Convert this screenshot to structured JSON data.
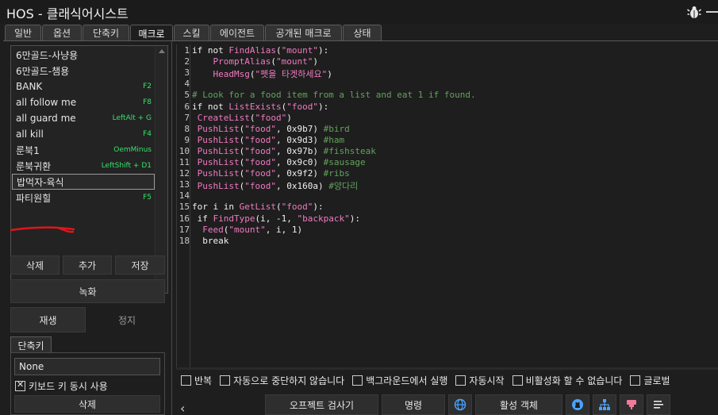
{
  "window": {
    "title": "HOS - 클래식어시스트"
  },
  "tabs": [
    "일반",
    "옵션",
    "단축키",
    "매크로",
    "스킬",
    "에이전트",
    "공개된 매크로",
    "상태"
  ],
  "active_tab": "매크로",
  "macros": [
    {
      "name": "6만골드-사냥용",
      "hotkey": ""
    },
    {
      "name": "6만골드-챔용",
      "hotkey": ""
    },
    {
      "name": "BANK",
      "hotkey": "F2"
    },
    {
      "name": "all follow me",
      "hotkey": "F8"
    },
    {
      "name": "all guard me",
      "hotkey": "LeftAlt + G"
    },
    {
      "name": "all kill",
      "hotkey": "F4"
    },
    {
      "name": "룬북1",
      "hotkey": "OemMinus"
    },
    {
      "name": "룬북귀환",
      "hotkey": "LeftShift + D1"
    },
    {
      "name": "밥먹자-육식",
      "hotkey": ""
    },
    {
      "name": "파티원힐",
      "hotkey": "F5"
    }
  ],
  "selected_macro": "밥먹자-육식",
  "buttons": {
    "delete": "삭제",
    "add": "추가",
    "save": "저장",
    "record": "녹화",
    "play": "재생",
    "stop": "정지"
  },
  "hotkey_panel": {
    "tab_label": "단축키",
    "value": "None",
    "checkbox_label": "키보드 키 동시 사용",
    "checkbox_checked": true,
    "delete_label": "삭제"
  },
  "editor": {
    "lines": [
      [
        [
          "kw",
          "if not "
        ],
        [
          "fn",
          "FindAlias"
        ],
        [
          "kw",
          "("
        ],
        [
          "str",
          "\"mount\""
        ],
        [
          "kw",
          "):"
        ]
      ],
      [
        [
          "kw",
          "    "
        ],
        [
          "fn",
          "PromptAlias"
        ],
        [
          "kw",
          "("
        ],
        [
          "str",
          "\"mount\""
        ],
        [
          "kw",
          ")"
        ]
      ],
      [
        [
          "kw",
          "    "
        ],
        [
          "fn",
          "HeadMsg"
        ],
        [
          "kw",
          "("
        ],
        [
          "str",
          "\"펫을 타겟하세요\""
        ],
        [
          "kw",
          ")"
        ]
      ],
      [],
      [
        [
          "cm",
          "# Look for a food item from a list and eat 1 if found."
        ]
      ],
      [
        [
          "kw",
          "if not "
        ],
        [
          "fn",
          "ListExists"
        ],
        [
          "kw",
          "("
        ],
        [
          "str",
          "\"food\""
        ],
        [
          "kw",
          "):"
        ]
      ],
      [
        [
          "kw",
          " "
        ],
        [
          "fn",
          "CreateList"
        ],
        [
          "kw",
          "("
        ],
        [
          "str",
          "\"food\""
        ],
        [
          "kw",
          ")"
        ]
      ],
      [
        [
          "kw",
          " "
        ],
        [
          "fn",
          "PushList"
        ],
        [
          "kw",
          "("
        ],
        [
          "str",
          "\"food\""
        ],
        [
          "kw",
          ", 0x9b7) "
        ],
        [
          "cm",
          "#bird"
        ]
      ],
      [
        [
          "kw",
          " "
        ],
        [
          "fn",
          "PushList"
        ],
        [
          "kw",
          "("
        ],
        [
          "str",
          "\"food\""
        ],
        [
          "kw",
          ", 0x9d3) "
        ],
        [
          "cm",
          "#ham"
        ]
      ],
      [
        [
          "kw",
          " "
        ],
        [
          "fn",
          "PushList"
        ],
        [
          "kw",
          "("
        ],
        [
          "str",
          "\"food\""
        ],
        [
          "kw",
          ", 0x97b) "
        ],
        [
          "cm",
          "#fishsteak"
        ]
      ],
      [
        [
          "kw",
          " "
        ],
        [
          "fn",
          "PushList"
        ],
        [
          "kw",
          "("
        ],
        [
          "str",
          "\"food\""
        ],
        [
          "kw",
          ", 0x9c0) "
        ],
        [
          "cm",
          "#sausage"
        ]
      ],
      [
        [
          "kw",
          " "
        ],
        [
          "fn",
          "PushList"
        ],
        [
          "kw",
          "("
        ],
        [
          "str",
          "\"food\""
        ],
        [
          "kw",
          ", 0x9f2) "
        ],
        [
          "cm",
          "#ribs"
        ]
      ],
      [
        [
          "kw",
          " "
        ],
        [
          "fn",
          "PushList"
        ],
        [
          "kw",
          "("
        ],
        [
          "str",
          "\"food\""
        ],
        [
          "kw",
          ", 0x160a) "
        ],
        [
          "cm",
          "#양다리"
        ]
      ],
      [],
      [
        [
          "kw",
          "for i in "
        ],
        [
          "fn",
          "GetList"
        ],
        [
          "kw",
          "("
        ],
        [
          "str",
          "\"food\""
        ],
        [
          "kw",
          "):"
        ]
      ],
      [
        [
          "kw",
          " if "
        ],
        [
          "fn",
          "FindType"
        ],
        [
          "kw",
          "(i, -1, "
        ],
        [
          "str",
          "\"backpack\""
        ],
        [
          "kw",
          "):"
        ]
      ],
      [
        [
          "kw",
          "  "
        ],
        [
          "fn",
          "Feed"
        ],
        [
          "kw",
          "("
        ],
        [
          "str",
          "\"mount\""
        ],
        [
          "kw",
          ", i, 1)"
        ]
      ],
      [
        [
          "kw",
          "  break"
        ]
      ]
    ]
  },
  "options": [
    {
      "label": "반복",
      "checked": false
    },
    {
      "label": "자동으로 중단하지 않습니다",
      "checked": false
    },
    {
      "label": "백그라운드에서 실행",
      "checked": false
    },
    {
      "label": "자동시작",
      "checked": false
    },
    {
      "label": "비활성화 할 수 없습니다",
      "checked": false
    },
    {
      "label": "글로벌",
      "checked": false
    }
  ],
  "toolbar": {
    "object_inspector": "오프젝트 검사기",
    "commands": "명령",
    "active_objects": "활성 객체"
  },
  "icons": [
    "bug-icon",
    "minimize-icon",
    "globe-icon",
    "github-icon",
    "hierarchy-icon",
    "stamp-icon",
    "list-icon",
    "chevron-left-icon"
  ],
  "colors": {
    "hotkey_text": "#35e36a",
    "function_text": "#f07ac0",
    "comment_text": "#62a35c",
    "underline_red": "#e0141c"
  }
}
